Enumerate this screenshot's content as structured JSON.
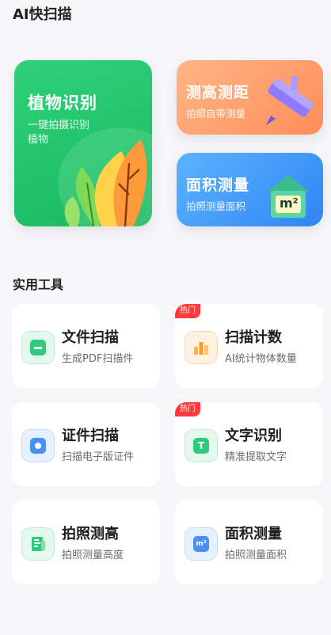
{
  "header": {
    "title": "AI快扫描"
  },
  "featured": {
    "plant": {
      "title": "植物识别",
      "subtitle": "一键拍摄识别植物"
    },
    "measure": {
      "title": "测高测距",
      "subtitle": "拍照自带测量"
    },
    "area": {
      "title": "面积测量",
      "subtitle": "拍照测量面积",
      "icon_text": "m²"
    }
  },
  "tools_section": {
    "title": "实用工具"
  },
  "tools": [
    {
      "name": "文件扫描",
      "desc": "生成PDF扫描件",
      "badge": ""
    },
    {
      "name": "扫描计数",
      "desc": "AI统计物体数量",
      "badge": "热门"
    },
    {
      "name": "证件扫描",
      "desc": "扫描电子版证件",
      "badge": ""
    },
    {
      "name": "文字识别",
      "desc": "精准提取文字",
      "badge": "热门"
    },
    {
      "name": "拍照测高",
      "desc": "拍照测量高度",
      "badge": ""
    },
    {
      "name": "面积测量",
      "desc": "拍照测量面积",
      "badge": "",
      "icon_text": "m²"
    }
  ],
  "colors": {
    "plant_green": "#20c36a",
    "measure_orange": "#ff8d5a",
    "area_blue": "#2f86f4",
    "hot_red": "#ff3b3b"
  }
}
